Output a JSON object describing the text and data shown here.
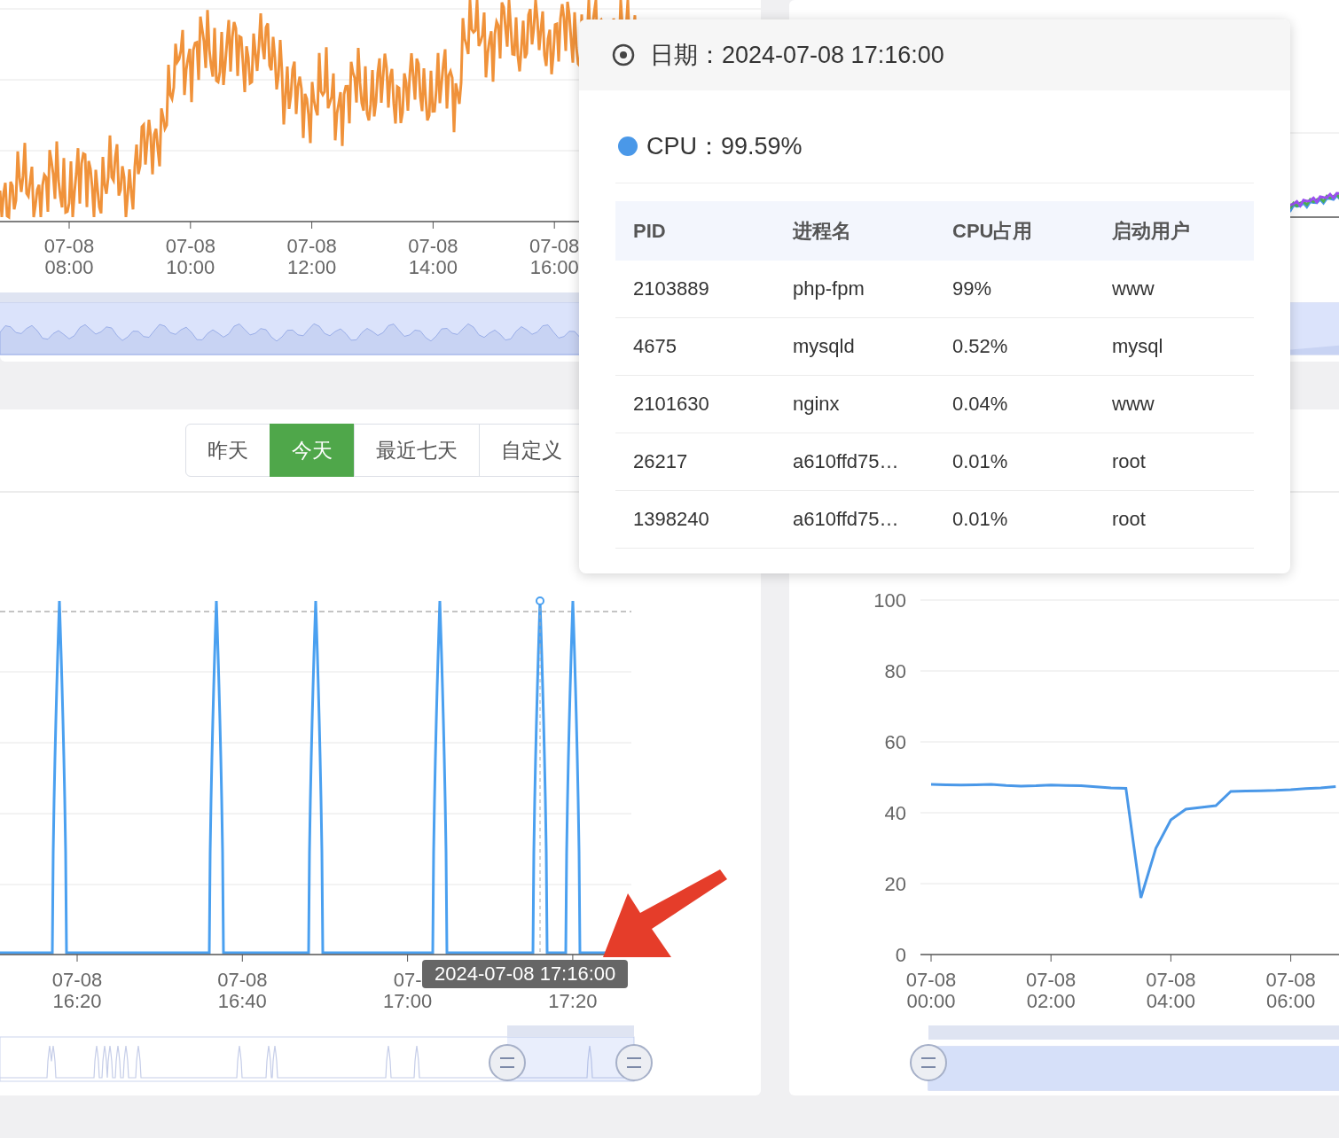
{
  "top_left_chart": {
    "x_labels": [
      "07-08 08:00",
      "07-08 10:00",
      "07-08 12:00",
      "07-08 14:00",
      "07-08 16:00"
    ],
    "slider": {
      "level": 1
    }
  },
  "top_right_chart": {
    "slider": {
      "level": 1
    }
  },
  "range_buttons": [
    {
      "label": "昨天",
      "selected": false
    },
    {
      "label": "今天",
      "selected": true
    },
    {
      "label": "最近七天",
      "selected": false
    },
    {
      "label": "自定义",
      "selected": false
    }
  ],
  "spike_chart": {
    "x_labels": [
      {
        "top": "07-08",
        "bottom": "16:20"
      },
      {
        "top": "07-08",
        "bottom": "16:40"
      },
      {
        "top": "07-",
        "bottom": "17:00"
      },
      {
        "bottom": "17:20"
      }
    ],
    "pointer_label": "2024-07-08 17:16:00",
    "slider": {
      "level": 0.2
    }
  },
  "percent_chart": {
    "chart_data": {
      "type": "line",
      "categories": [
        "07-08 00:00",
        null,
        null,
        null,
        null,
        null,
        null,
        null,
        "07-08 02:00",
        null,
        null,
        null,
        null,
        null,
        null,
        null,
        "07-08 04:00",
        null,
        null,
        null,
        null,
        null,
        null,
        null,
        "07-08 06:00",
        null,
        null,
        null
      ],
      "series": [
        {
          "values": [
            48,
            47.9,
            47.8,
            47.9,
            48,
            47.7,
            47.5,
            47.6,
            47.8,
            47.7,
            47.6,
            47.3,
            47,
            46.9,
            16,
            30,
            38,
            41,
            41.5,
            42,
            46,
            46.1,
            46.2,
            46.3,
            46.5,
            46.8,
            47,
            47.4
          ]
        }
      ],
      "ylim": [
        0,
        100
      ],
      "grid": true,
      "yticks": [
        0,
        20,
        40,
        60,
        80,
        100
      ]
    },
    "slider": {
      "level": 1
    }
  },
  "tooltip": {
    "date": "日期：2024-07-08 17:16:00",
    "series": "CPU：99.59%",
    "table": {
      "columns": [
        "PID",
        "进程名",
        "CPU占用",
        "启动用户"
      ],
      "rows": [
        [
          "2103889",
          "php-fpm",
          "99%",
          "www"
        ],
        [
          "4675",
          "mysqld",
          "0.52%",
          "mysql"
        ],
        [
          "2101630",
          "nginx",
          "0.04%",
          "www"
        ],
        [
          "26217",
          "a610ffd75…",
          "0.01%",
          "root"
        ],
        [
          "1398240",
          "a610ffd75…",
          "0.01%",
          "root"
        ]
      ]
    }
  }
}
